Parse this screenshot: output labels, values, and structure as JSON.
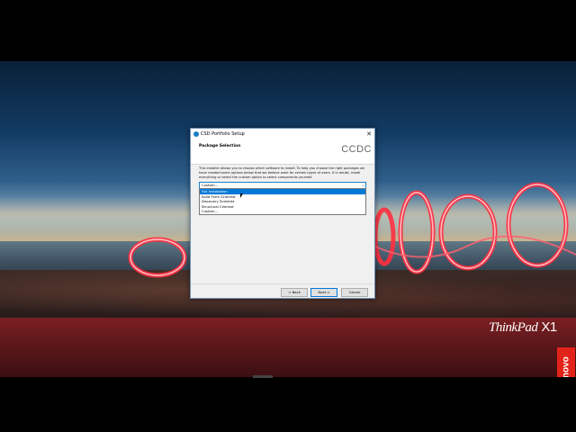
{
  "dialog": {
    "title": "CSD Portfolio Setup",
    "section_title": "Package Selection",
    "logo_text": "CCDC",
    "description": "This installer allows you to choose which software to install. To help you choose the right packages we have created some options below that we believe work for certain types of users. If in doubt, install everything or select the custom option to select components yourself.",
    "combo_value": "Custom...",
    "options": [
      "Full Installation",
      "Solid Form Scientist",
      "Discovery Scientist",
      "Structural Chemist",
      "Custom..."
    ],
    "selected_option": "Full Installation",
    "buttons": {
      "back": "< Back",
      "next": "Next >",
      "cancel": "Cancel"
    }
  },
  "desktop": {
    "brand": "ThinkPad",
    "brand_model": "X1",
    "logo": "Lenovo"
  },
  "colors": {
    "accent": "#0078d7",
    "lenovo_red": "#e2231a",
    "icon_blue": "#1a7fc4"
  }
}
